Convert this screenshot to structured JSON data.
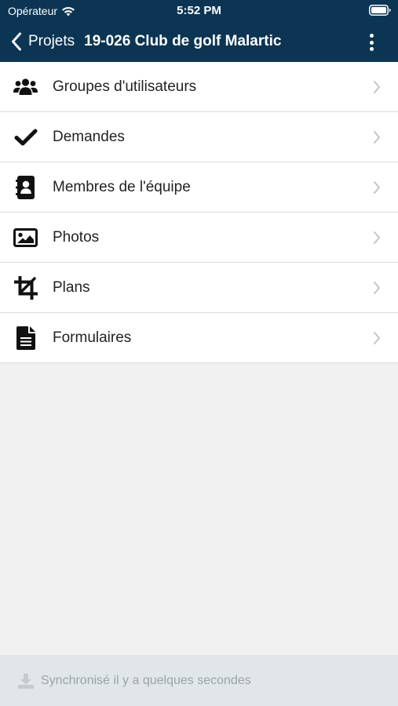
{
  "status_bar": {
    "carrier": "Opérateur",
    "time": "5:52 PM"
  },
  "nav": {
    "back_label": "Projets",
    "title": "19-026 Club de golf Malartic"
  },
  "menu": {
    "items": [
      {
        "label": "Groupes d'utilisateurs",
        "icon": "users-group-icon"
      },
      {
        "label": "Demandes",
        "icon": "checkmark-icon"
      },
      {
        "label": "Membres de l'équipe",
        "icon": "contact-book-icon"
      },
      {
        "label": "Photos",
        "icon": "image-icon"
      },
      {
        "label": "Plans",
        "icon": "crop-icon"
      },
      {
        "label": "Formulaires",
        "icon": "document-icon"
      }
    ]
  },
  "footer": {
    "sync_text": "Synchronisé il y a quelques secondes"
  },
  "colors": {
    "header_bg": "#0c3554",
    "footer_bg": "#e1e6e9",
    "page_bg": "#f0f0f0"
  }
}
